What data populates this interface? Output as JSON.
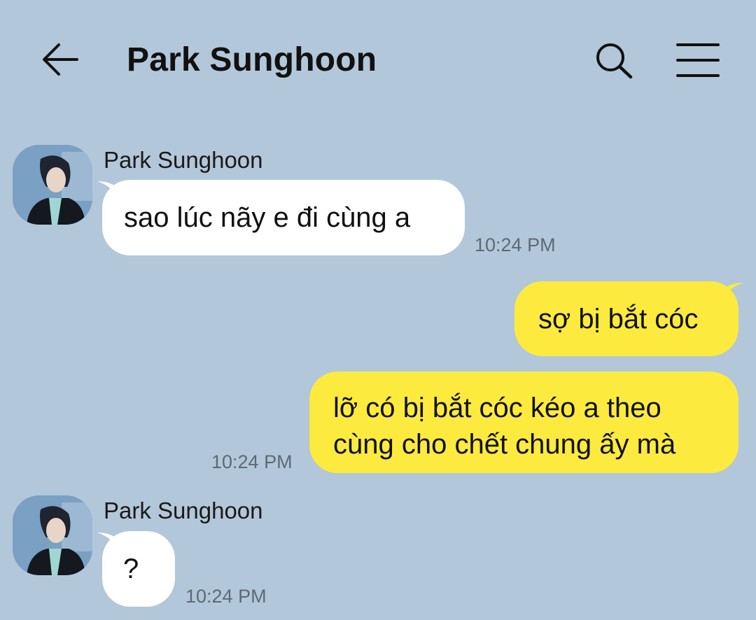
{
  "header": {
    "title": "Park Sunghoon",
    "icons": {
      "back": "arrow-left-icon",
      "search": "search-icon",
      "menu": "hamburger-menu-icon"
    }
  },
  "messages": [
    {
      "direction": "incoming",
      "sender": "Park Sunghoon",
      "text": "sao lúc nãy e đi cùng a",
      "time": "10:24 PM"
    },
    {
      "direction": "outgoing",
      "text": "sợ bị bắt cóc"
    },
    {
      "direction": "outgoing",
      "text_line1": "lỡ có bị bắt cóc kéo a theo",
      "text_line2": "cùng cho chết chung ấy mà",
      "time": "10:24 PM"
    },
    {
      "direction": "incoming",
      "sender": "Park Sunghoon",
      "text": "?",
      "time": "10:24 PM"
    }
  ],
  "colors": {
    "background": "#b2c7da",
    "incoming_bubble": "#ffffff",
    "outgoing_bubble": "#fdea3e",
    "time_text": "#5d6a76"
  }
}
